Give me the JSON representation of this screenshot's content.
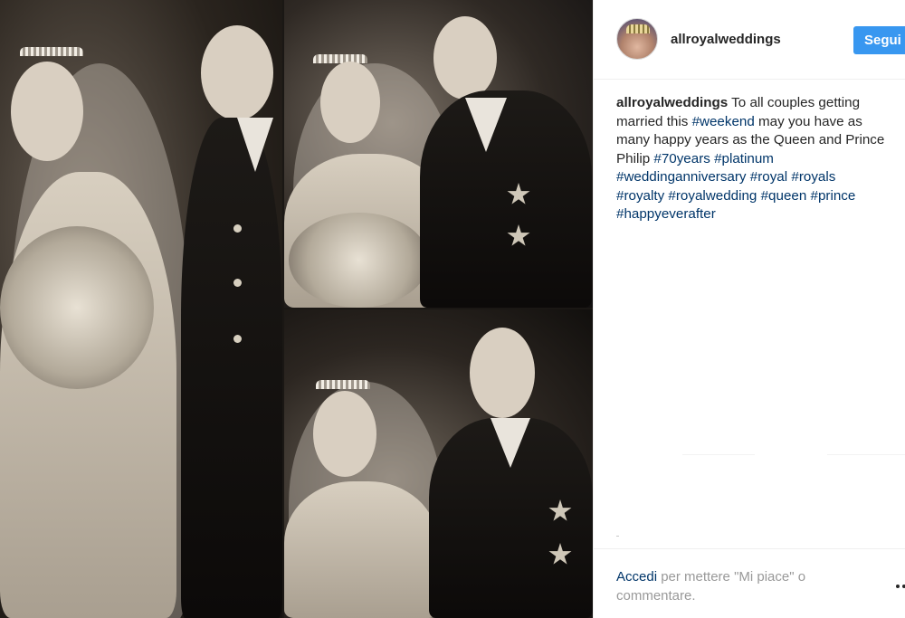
{
  "post": {
    "username": "allroyalweddings",
    "follow_label": "Segui",
    "caption": {
      "author": "allroyalweddings",
      "lines": [
        [
          {
            "t": " To all couples getting",
            "tag": false
          }
        ],
        [
          {
            "t": "married this ",
            "tag": false
          },
          {
            "t": "#weekend",
            "tag": true
          },
          {
            "t": " may you have as",
            "tag": false
          }
        ],
        [
          {
            "t": "many happy years as the Queen and Prince",
            "tag": false
          }
        ],
        [
          {
            "t": "Philip ",
            "tag": false
          },
          {
            "t": "#70years",
            "tag": true
          },
          {
            "t": " ",
            "tag": false
          },
          {
            "t": "#platinum",
            "tag": true
          }
        ],
        [
          {
            "t": "#weddinganniversary",
            "tag": true
          },
          {
            "t": " ",
            "tag": false
          },
          {
            "t": "#royal",
            "tag": true
          },
          {
            "t": " ",
            "tag": false
          },
          {
            "t": "#royals",
            "tag": true
          }
        ],
        [
          {
            "t": "#royalty",
            "tag": true
          },
          {
            "t": " ",
            "tag": false
          },
          {
            "t": "#royalwedding",
            "tag": true
          },
          {
            "t": " ",
            "tag": false
          },
          {
            "t": "#queen",
            "tag": true
          },
          {
            "t": " ",
            "tag": false
          },
          {
            "t": "#prince",
            "tag": true
          }
        ],
        [
          {
            "t": "#happyeverafter",
            "tag": true
          }
        ]
      ]
    }
  },
  "footer": {
    "login_link": "Accedi",
    "login_text_line1": " per mettere \"Mi piace\" o",
    "login_text_line2": "commentare."
  },
  "icons": {
    "more": "more-options-icon",
    "avatar": "avatar"
  },
  "colors": {
    "follow_button": "#3897f0",
    "hashtag": "#003569",
    "muted_text": "#999999",
    "text": "#262626"
  }
}
